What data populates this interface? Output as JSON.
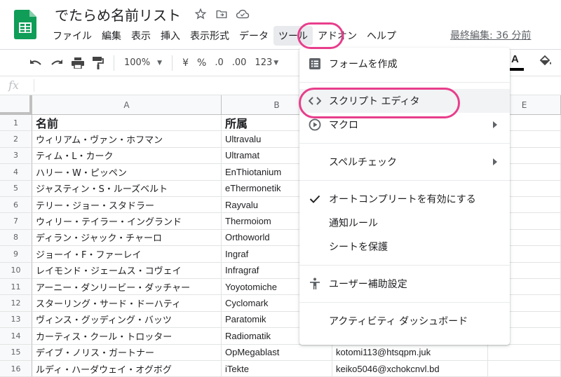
{
  "app": {
    "doc_title": "でたらめ名前リスト",
    "last_edit": "最終編集: 36 分前"
  },
  "menubar": {
    "items": [
      "ファイル",
      "編集",
      "表示",
      "挿入",
      "表示形式",
      "データ",
      "ツール",
      "アドオン",
      "ヘルプ"
    ],
    "active": "ツール"
  },
  "toolbar": {
    "zoom": "100%",
    "currency": "¥",
    "percent": "%",
    "dec_decrease": ".0",
    "dec_increase": ".00",
    "more_formats": "123",
    "text_color_label": "A"
  },
  "formula_bar": {
    "fx_label": "fx"
  },
  "grid": {
    "columns": [
      "A",
      "B",
      "E"
    ],
    "rows": [
      {
        "num": "1",
        "a": "名前",
        "b": "所属",
        "c": ""
      },
      {
        "num": "2",
        "a": "ウィリアム・ヴァン・ホフマン",
        "b": "Ultravalu",
        "c": ""
      },
      {
        "num": "3",
        "a": "ティム・L・カーク",
        "b": "Ultramat",
        "c": ""
      },
      {
        "num": "4",
        "a": "ハリー・W・ピッペン",
        "b": "EnThiotanium",
        "c": ""
      },
      {
        "num": "5",
        "a": "ジャスティン・S・ルーズベルト",
        "b": "eThermonetik",
        "c": ""
      },
      {
        "num": "6",
        "a": "テリー・ジョー・スタドラー",
        "b": "Rayvalu",
        "c": ""
      },
      {
        "num": "7",
        "a": "ウィリー・テイラー・イングランド",
        "b": "Thermoiom",
        "c": ""
      },
      {
        "num": "8",
        "a": "ディラン・ジャック・チャーロ",
        "b": "Orthoworld",
        "c": ""
      },
      {
        "num": "9",
        "a": "ジョーイ・F・ファーレイ",
        "b": "Ingraf",
        "c": ""
      },
      {
        "num": "10",
        "a": "レイモンド・ジェームス・コヴェイ",
        "b": "Infragraf",
        "c": ""
      },
      {
        "num": "11",
        "a": "アーニー・ダンリービー・ダッチャー",
        "b": "Yoyotomiche",
        "c": ""
      },
      {
        "num": "12",
        "a": "スターリング・サード・ドーハティ",
        "b": "Cyclomark",
        "c": ""
      },
      {
        "num": "13",
        "a": "ヴィンス・グッディング・バッツ",
        "b": "Paratomik",
        "c": ""
      },
      {
        "num": "14",
        "a": "カーティス・クール・トロッター",
        "b": "Radiomatik",
        "c": ""
      },
      {
        "num": "15",
        "a": "デイブ・ノリス・ガートナー",
        "b": "OpMegablast",
        "c": "kotomi113@htsqpm.juk"
      },
      {
        "num": "16",
        "a": "ルディ・ハーダウェイ・オグボグ",
        "b": "iTekte",
        "c": "keiko5046@xchokcnvl.bd"
      }
    ]
  },
  "tools_menu": {
    "create_form": "フォームを作成",
    "script_editor": "スクリプト エディタ",
    "macros": "マクロ",
    "spellcheck": "スペルチェック",
    "autocomplete": "オートコンプリートを有効にする",
    "notification_rules": "通知ルール",
    "protect_sheet": "シートを保護",
    "accessibility": "ユーザー補助設定",
    "activity_dashboard": "アクティビティ ダッシュボード"
  },
  "colors": {
    "highlight": "#e83e8c",
    "sheets_green": "#0f9d58"
  }
}
